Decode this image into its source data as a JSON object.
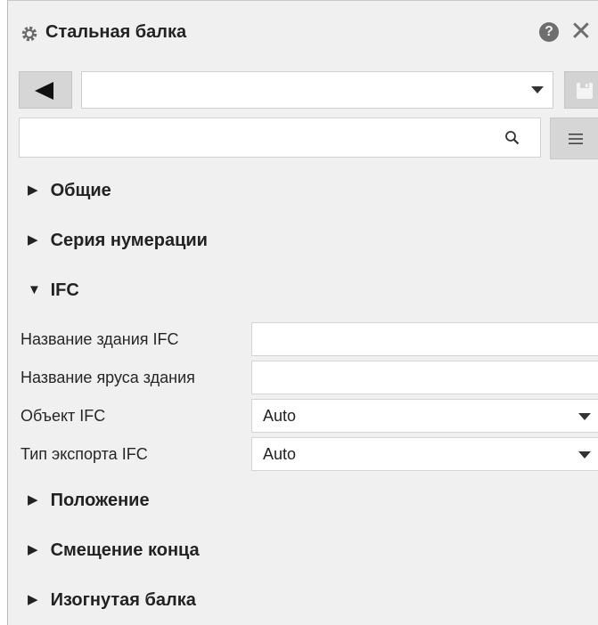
{
  "window": {
    "title": "Стальная балка",
    "help_label": "?",
    "close_label": "✕"
  },
  "toolbar": {
    "back_icon": "left-triangle-icon",
    "preset_value": "",
    "save_icon": "save-disk-icon"
  },
  "search": {
    "value": "",
    "placeholder": "",
    "menu_icon": "hamburger-icon"
  },
  "sections": {
    "general": {
      "arrow": "▶",
      "label": "Общие"
    },
    "numbering": {
      "arrow": "▶",
      "label": "Серия нумерации"
    },
    "ifc": {
      "arrow": "▼",
      "label": "IFC"
    },
    "position": {
      "arrow": "▶",
      "label": "Положение"
    },
    "end_offset": {
      "arrow": "▶",
      "label": "Смещение конца"
    },
    "curved_beam": {
      "arrow": "▶",
      "label": "Изогнутая балка"
    }
  },
  "ifc_properties": {
    "building_name": {
      "label": "Название здания IFC",
      "value": ""
    },
    "storey_name": {
      "label": "Название яруса здания",
      "value": ""
    },
    "ifc_entity": {
      "label": "Объект IFC",
      "value": "Auto"
    },
    "export_type": {
      "label": "Тип экспорта IFC",
      "value": "Auto"
    }
  },
  "colors": {
    "panel_bg": "#f0f0f0",
    "button_bg": "#d6d6d6",
    "field_bg": "#ffffff",
    "icon_gray": "#6e6e6e"
  }
}
